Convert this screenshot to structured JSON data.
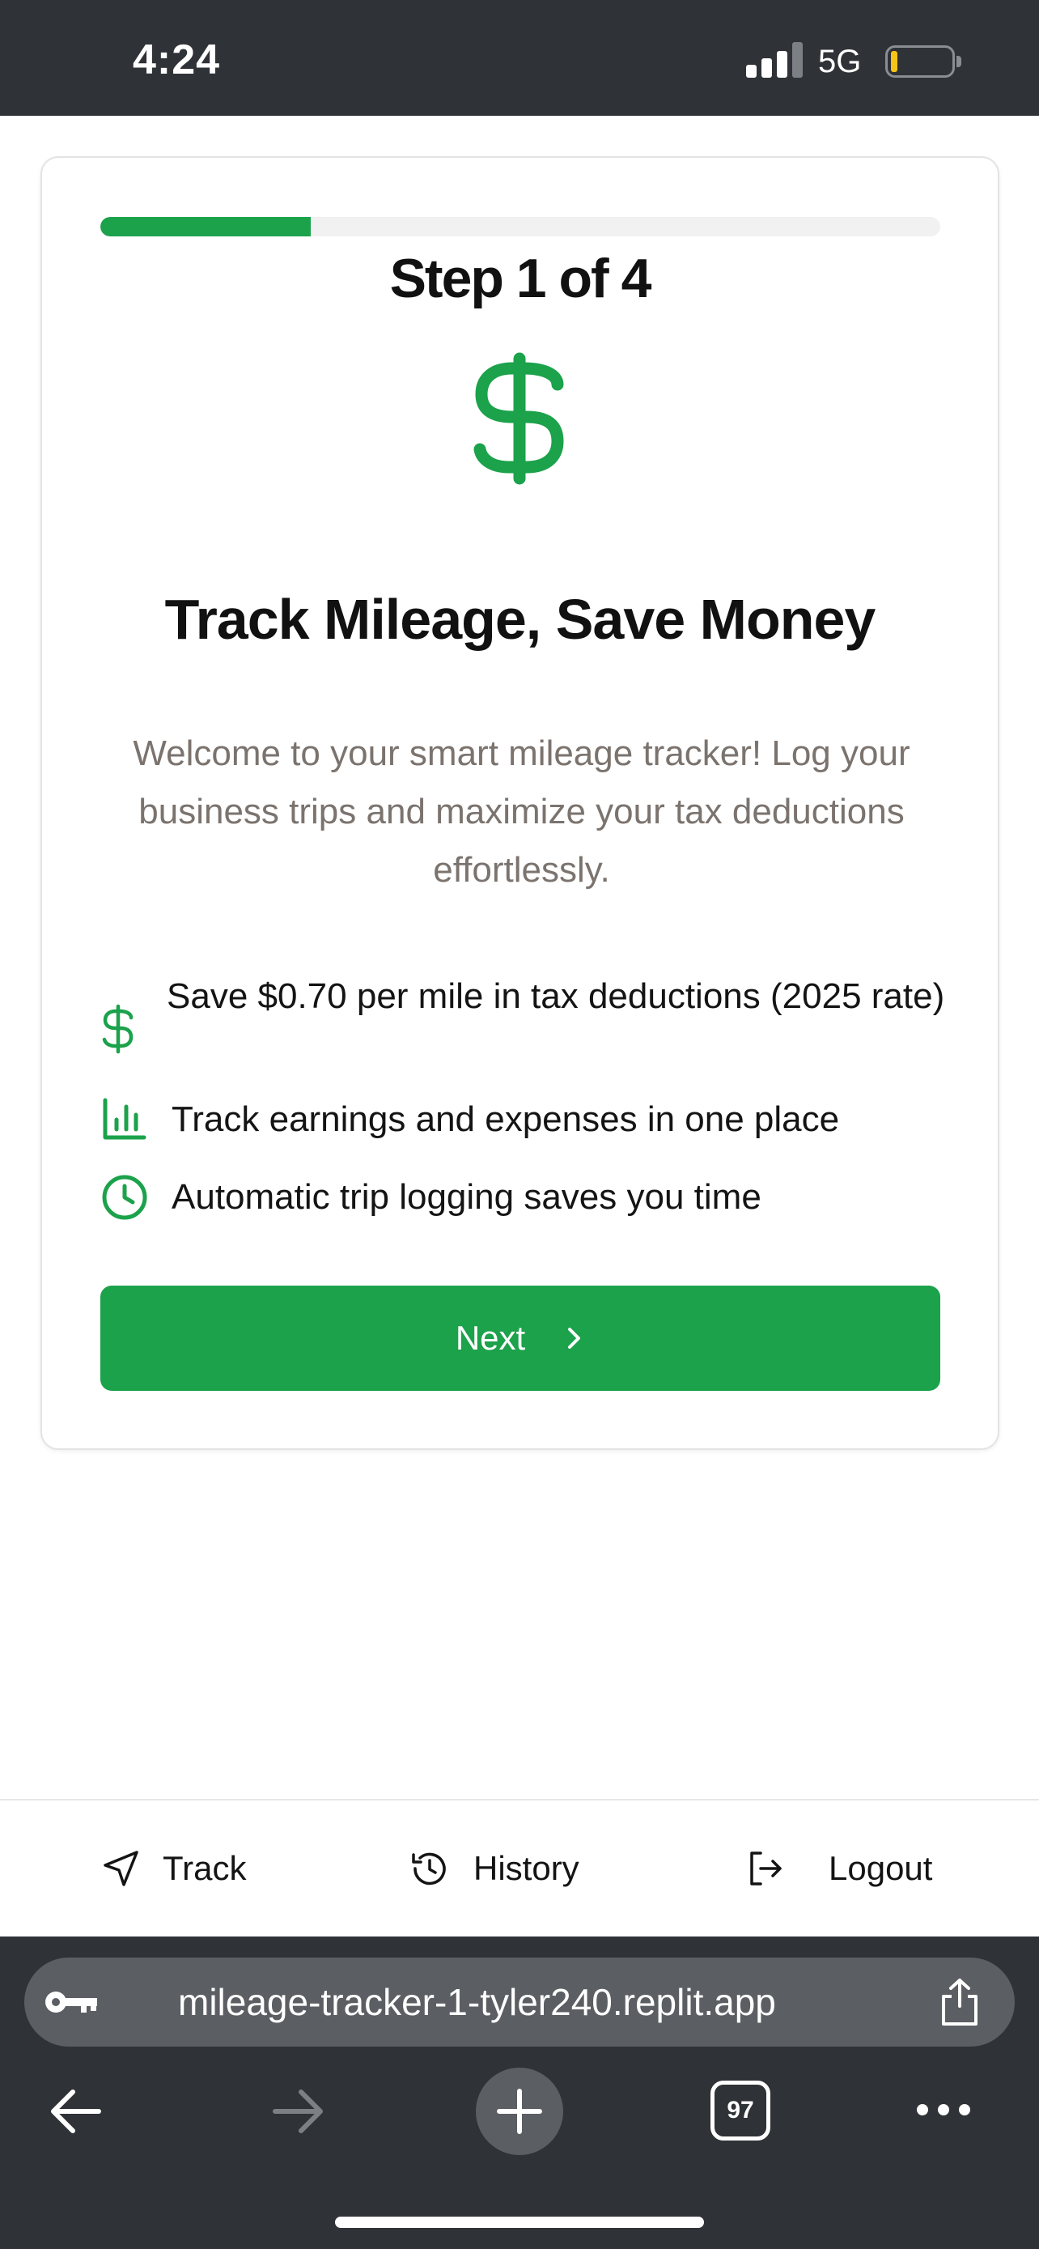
{
  "status_bar": {
    "time": "4:24",
    "network": "5G",
    "signal_bars_active": 3,
    "signal_bars_total": 4,
    "battery_level": 0.1
  },
  "onboarding": {
    "progress": {
      "current_step": 1,
      "total_steps": 4,
      "fraction": 0.25
    },
    "step_label": "Step 1 of 4",
    "hero_icon": "dollar-sign-icon",
    "title": "Track Mileage, Save Money",
    "description": "Welcome to your smart mileage tracker! Log your business trips and maximize your tax deductions effortlessly.",
    "features": [
      {
        "icon": "dollar-sign-icon",
        "text": "Save $0.70 per mile in tax deductions (2025 rate)"
      },
      {
        "icon": "bar-chart-icon",
        "text": "Track earnings and expenses in one place"
      },
      {
        "icon": "clock-icon",
        "text": "Automatic trip logging saves you time"
      }
    ],
    "next_button": {
      "label": "Next",
      "icon": "chevron-right-icon"
    }
  },
  "app_nav": {
    "items": [
      {
        "label": "Track",
        "icon": "navigation-arrow-icon"
      },
      {
        "label": "History",
        "icon": "history-icon"
      },
      {
        "label": "Logout",
        "icon": "logout-icon"
      }
    ]
  },
  "browser": {
    "url": "mileage-tracker-1-tyler240.replit.app",
    "tab_count": "97",
    "icons": [
      "key-icon",
      "share-icon",
      "back-arrow-icon",
      "forward-arrow-icon",
      "plus-icon",
      "tabs-icon",
      "more-icon"
    ]
  },
  "colors": {
    "accent": "#1ba24b",
    "text_primary": "#111111",
    "text_muted": "#7b736e",
    "chrome_dark": "#2f3236",
    "url_bar": "#5b5e62",
    "battery": "#f5c518"
  }
}
